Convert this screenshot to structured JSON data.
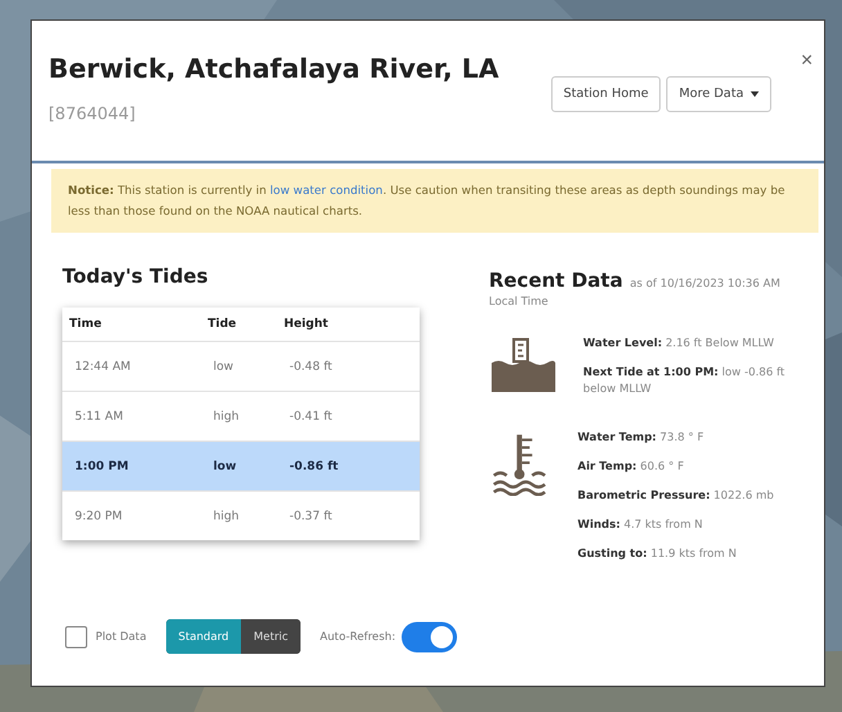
{
  "dialog": {
    "title": "Berwick, Atchafalaya River, LA",
    "station_id": "[8764044]",
    "buttons": [
      {
        "label": "Station Home",
        "kind": "plain"
      },
      {
        "label": "More Data",
        "kind": "dropdown"
      }
    ],
    "close": "×"
  },
  "notice": {
    "before": "**Notice:** This station is currently in ",
    "link": "low water condition",
    "after": ". Use caution when transiting these areas as depth soundings may be less than those found on the NOAA nautical charts."
  },
  "tides": {
    "title": "Today's Tides",
    "columns": [
      "Time",
      "Tide",
      "Height"
    ],
    "rows": [
      {
        "cells": [
          "12:44 AM",
          "low",
          "-0.48 ft"
        ],
        "selected": false
      },
      {
        "cells": [
          "5:11 AM",
          "high",
          "-0.41 ft"
        ],
        "selected": false
      },
      {
        "cells": [
          "1:00 PM",
          "low",
          "-0.86 ft"
        ],
        "selected": true
      },
      {
        "cells": [
          "9:20 PM",
          "high",
          "-0.37 ft"
        ],
        "selected": false
      }
    ]
  },
  "recent": {
    "title": "Recent Data",
    "as_of": "as of 10/16/2023 10:36 AM",
    "subtitle": "Local Time",
    "groups": [
      {
        "kind": "water",
        "lines": [
          "**Water Level:** 2.16 ft Below MLLW",
          "**Next Tide at 1:00 PM:** low -0.86 ft below MLLW"
        ]
      },
      {
        "kind": "temperature",
        "lines": [
          "**Water Temp:** 73.8 ° F",
          "**Air Temp:** 60.6 ° F",
          "**Barometric Pressure:** 1022.6 mb",
          "**Winds:** 4.7 kts from N",
          "**Gusting to:** 11.9 kts from N"
        ]
      }
    ]
  },
  "controls": {
    "plot": {
      "label": "Plot Data",
      "checked": false
    },
    "units": [
      {
        "label": "Standard",
        "selected": true
      },
      {
        "label": "Metric",
        "selected": false
      }
    ],
    "refresh": {
      "label": "Auto-Refresh:",
      "on": true
    }
  }
}
